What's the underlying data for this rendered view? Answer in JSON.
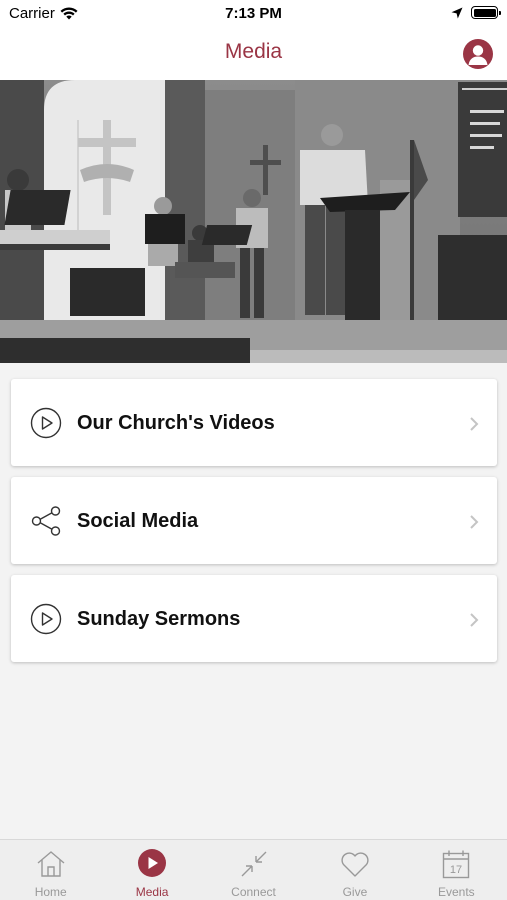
{
  "status_bar": {
    "carrier": "Carrier",
    "time": "7:13 PM"
  },
  "nav": {
    "title": "Media"
  },
  "menu": [
    {
      "label": "Our Church's Videos",
      "icon": "play-circle-icon"
    },
    {
      "label": "Social Media",
      "icon": "share-icon"
    },
    {
      "label": "Sunday Sermons",
      "icon": "play-circle-icon"
    }
  ],
  "tabs": [
    {
      "label": "Home",
      "icon": "home-icon",
      "active": false
    },
    {
      "label": "Media",
      "icon": "play-circle-icon",
      "active": true
    },
    {
      "label": "Connect",
      "icon": "connect-arrows-icon",
      "active": false
    },
    {
      "label": "Give",
      "icon": "heart-icon",
      "active": false
    },
    {
      "label": "Events",
      "icon": "calendar-icon",
      "active": false,
      "calendar_day": "17"
    }
  ],
  "colors": {
    "accent": "#9a3545",
    "tab_inactive": "#999999",
    "background": "#f3f3f3"
  }
}
